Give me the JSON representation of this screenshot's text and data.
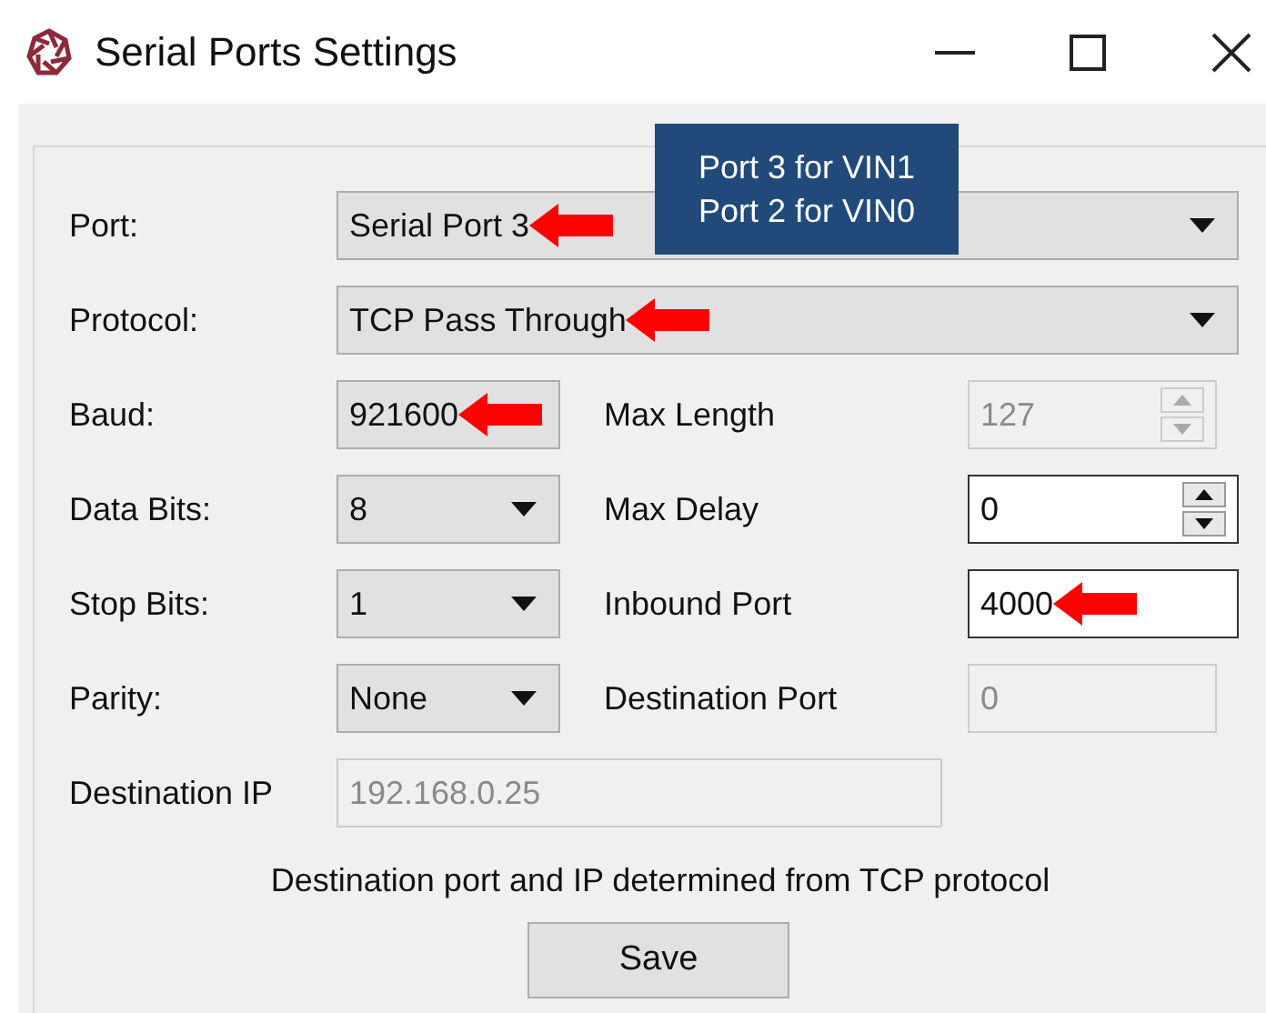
{
  "window": {
    "title": "Serial Ports Settings"
  },
  "fields": [
    {
      "label": "Port:",
      "kind": "dropdown",
      "value": "Serial Port 3",
      "arrow": true,
      "disabled": false
    },
    {
      "label": "Protocol:",
      "kind": "dropdown",
      "value": "TCP Pass Through",
      "arrow": true,
      "disabled": false
    },
    {
      "label": "Baud:",
      "kind": "display",
      "value": "921600",
      "arrow": true,
      "disabled": false,
      "right": {
        "label": "Max Length",
        "kind": "spinner",
        "value": "127",
        "disabled": true,
        "arrow": false
      }
    },
    {
      "label": "Data Bits:",
      "kind": "dropdown",
      "value": "8",
      "arrow": false,
      "disabled": false,
      "right": {
        "label": "Max Delay",
        "kind": "spinner",
        "value": "0",
        "disabled": false,
        "arrow": false
      }
    },
    {
      "label": "Stop Bits:",
      "kind": "dropdown",
      "value": "1",
      "arrow": false,
      "disabled": false,
      "right": {
        "label": "Inbound Port",
        "kind": "text",
        "value": "4000",
        "disabled": false,
        "arrow": true
      }
    },
    {
      "label": "Parity:",
      "kind": "dropdown",
      "value": "None",
      "arrow": false,
      "disabled": false,
      "right": {
        "label": "Destination Port",
        "kind": "text",
        "value": "0",
        "disabled": true,
        "arrow": false
      }
    },
    {
      "label": "Destination IP",
      "kind": "text",
      "value": "192.168.0.25",
      "arrow": false,
      "disabled": true
    }
  ],
  "note": "Destination port and IP determined from TCP protocol",
  "save_button": "Save",
  "callout": [
    "Port 3 for VIN1",
    "Port 2 for VIN0"
  ]
}
